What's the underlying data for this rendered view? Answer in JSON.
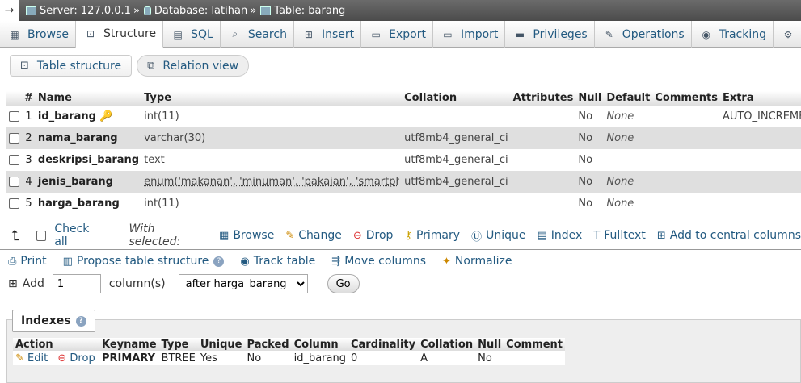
{
  "breadcrumb": {
    "back_arrow": "→",
    "server": "Server: 127.0.0.1",
    "database": "Database: latihan",
    "table": "Table: barang",
    "separator": "»"
  },
  "tabs": [
    {
      "label": "Browse",
      "icon": "browse-icon"
    },
    {
      "label": "Structure",
      "icon": "structure-icon"
    },
    {
      "label": "SQL",
      "icon": "sql-icon"
    },
    {
      "label": "Search",
      "icon": "search-icon"
    },
    {
      "label": "Insert",
      "icon": "insert-icon"
    },
    {
      "label": "Export",
      "icon": "export-icon"
    },
    {
      "label": "Import",
      "icon": "import-icon"
    },
    {
      "label": "Privileges",
      "icon": "privileges-icon"
    },
    {
      "label": "Operations",
      "icon": "operations-icon"
    },
    {
      "label": "Tracking",
      "icon": "tracking-icon"
    }
  ],
  "subtabs": {
    "table_structure": "Table structure",
    "relation_view": "Relation view"
  },
  "columns": {
    "headers": [
      "#",
      "Name",
      "Type",
      "Collation",
      "Attributes",
      "Null",
      "Default",
      "Comments",
      "Extra"
    ],
    "rows": [
      {
        "num": "1",
        "name": "id_barang",
        "type": "int(11)",
        "collation": "",
        "attributes": "",
        "null": "No",
        "default": "None",
        "comments": "",
        "extra": "AUTO_INCREMENT"
      },
      {
        "num": "2",
        "name": "nama_barang",
        "type": "varchar(30)",
        "collation": "utf8mb4_general_ci",
        "attributes": "",
        "null": "No",
        "default": "None",
        "comments": "",
        "extra": ""
      },
      {
        "num": "3",
        "name": "deskripsi_barang",
        "type": "text",
        "collation": "utf8mb4_general_ci",
        "attributes": "",
        "null": "No",
        "default": "",
        "comments": "",
        "extra": ""
      },
      {
        "num": "4",
        "name": "jenis_barang",
        "type": "enum('makanan', 'minuman', 'pakaian', 'smartphone'...",
        "collation": "utf8mb4_general_ci",
        "attributes": "",
        "null": "No",
        "default": "None",
        "comments": "",
        "extra": ""
      },
      {
        "num": "5",
        "name": "harga_barang",
        "type": "int(11)",
        "collation": "",
        "attributes": "",
        "null": "No",
        "default": "None",
        "comments": "",
        "extra": ""
      }
    ]
  },
  "with_selected": {
    "check_all": "Check all",
    "label": "With selected:",
    "actions": [
      "Browse",
      "Change",
      "Drop",
      "Primary",
      "Unique",
      "Index",
      "Fulltext",
      "Add to central columns"
    ]
  },
  "tools": [
    "Print",
    "Propose table structure",
    "Track table",
    "Move columns",
    "Normalize"
  ],
  "add_row": {
    "label": "Add",
    "value": "1",
    "unit": "column(s)",
    "position": "after harga_barang",
    "go": "Go"
  },
  "indexes": {
    "title": "Indexes",
    "headers": [
      "Action",
      "Keyname",
      "Type",
      "Unique",
      "Packed",
      "Column",
      "Cardinality",
      "Collation",
      "Null",
      "Comment"
    ],
    "row": {
      "edit": "Edit",
      "drop": "Drop",
      "keyname": "PRIMARY",
      "type": "BTREE",
      "unique": "Yes",
      "packed": "No",
      "column": "id_barang",
      "cardinality": "0",
      "collation": "A",
      "null": "No",
      "comment": ""
    }
  }
}
